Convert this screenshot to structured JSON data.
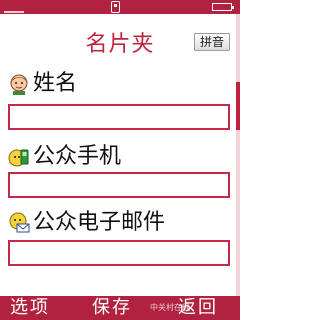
{
  "header": {
    "title": "名片夹",
    "ime_label": "拼音"
  },
  "fields": [
    {
      "label": "姓名",
      "value": "",
      "icon": "person-icon"
    },
    {
      "label": "公众手机",
      "value": "",
      "icon": "mobile-phone-icon"
    },
    {
      "label": "公众电子邮件",
      "value": "",
      "icon": "email-icon"
    }
  ],
  "softkeys": {
    "left": "选项",
    "center": "保存",
    "right": "返回"
  },
  "watermark": "中关村在线",
  "colors": {
    "accent": "#b0223f",
    "title": "#c0233f",
    "input_border": "#c42a48"
  }
}
